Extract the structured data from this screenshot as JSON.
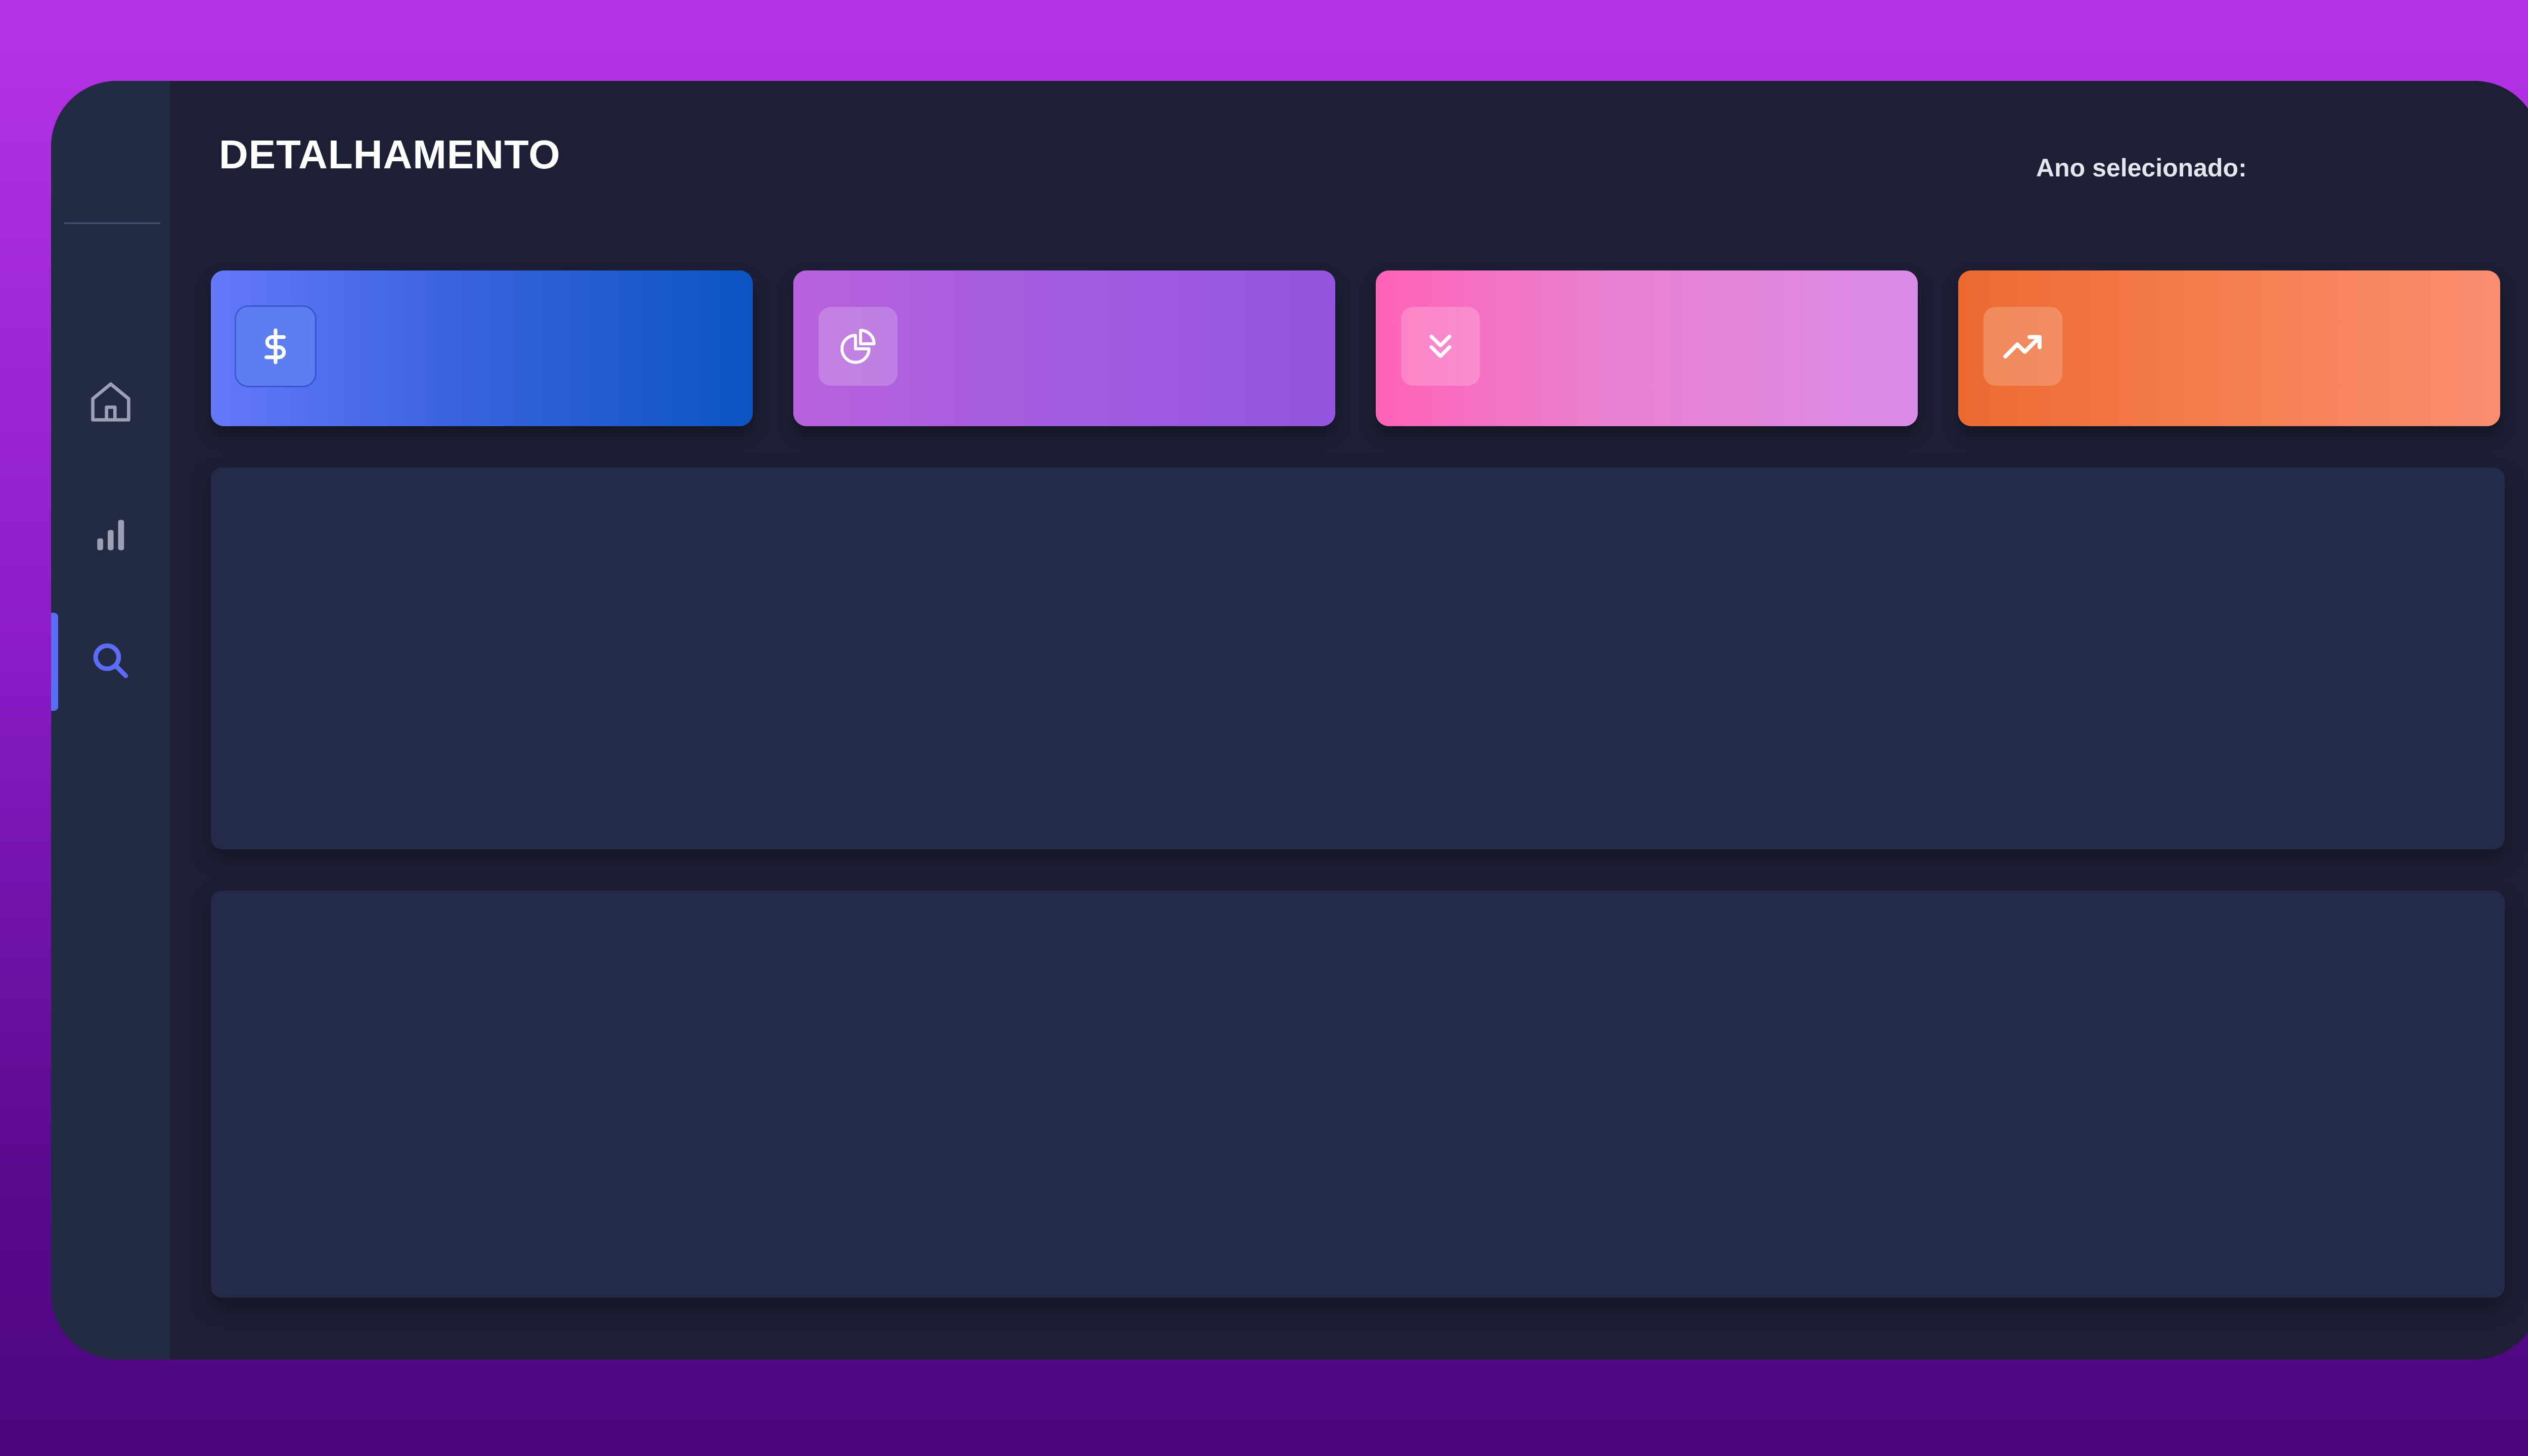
{
  "header": {
    "title": "DETALHAMENTO",
    "year_label": "Ano selecionado:"
  },
  "sidebar": {
    "items": [
      {
        "name": "home",
        "icon": "home-icon",
        "active": false
      },
      {
        "name": "stats",
        "icon": "bar-chart-icon",
        "active": false
      },
      {
        "name": "search",
        "icon": "search-icon",
        "active": true
      }
    ]
  },
  "kpi_cards": [
    {
      "icon": "dollar-icon",
      "color_start": "#6478fb",
      "color_end": "#0b55c0"
    },
    {
      "icon": "pie-chart-icon",
      "color_start": "#b762dc",
      "color_end": "#9554df"
    },
    {
      "icon": "chevrons-down-icon",
      "color_start": "#ff63b6",
      "color_end": "#d98ce7"
    },
    {
      "icon": "trending-up-icon",
      "color_start": "#ec6a30",
      "color_end": "#fb8d70"
    }
  ],
  "colors": {
    "background_top": "#b534e6",
    "background_bottom": "#4d057d",
    "window": "#1d1f35",
    "sidebar": "#232a44",
    "panel": "#242b48",
    "accent": "#5b6cf5"
  }
}
